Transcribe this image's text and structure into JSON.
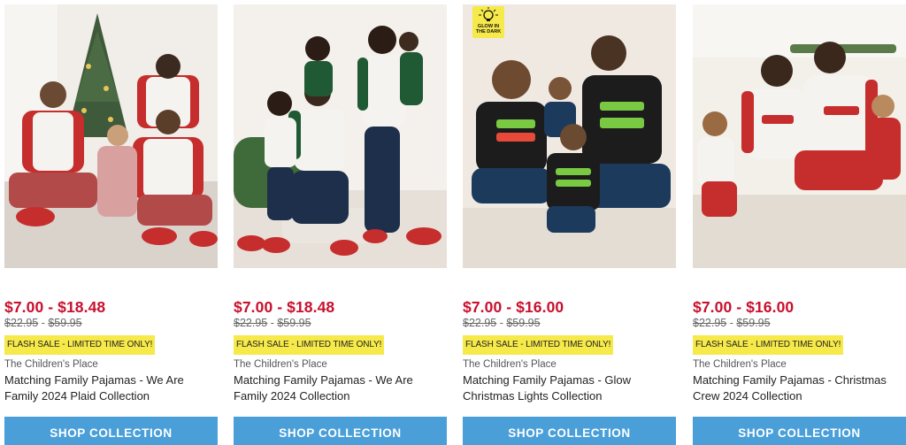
{
  "products": [
    {
      "price": "$7.00 - $18.48",
      "was_low": "$22.95",
      "was_sep": " - ",
      "was_high": "$59.95",
      "flash": "FLASH SALE - LIMITED TIME ONLY!",
      "brand": "The Children's Place",
      "title": "Matching Family Pajamas - We Are Family 2024 Plaid Collection",
      "cta": "SHOP COLLECTION",
      "image_alt": "Family in red plaid pajamas by a Christmas tree"
    },
    {
      "price": "$7.00 - $18.48",
      "was_low": "$22.95",
      "was_sep": " - ",
      "was_high": "$59.95",
      "flash": "FLASH SALE - LIMITED TIME ONLY!",
      "brand": "The Children's Place",
      "title": "Matching Family Pajamas - We Are Family 2024 Collection",
      "cta": "SHOP COLLECTION",
      "image_alt": "Family in green plaid pajamas"
    },
    {
      "price": "$7.00 - $16.00",
      "was_low": "$22.95",
      "was_sep": " - ",
      "was_high": "$59.95",
      "flash": "FLASH SALE - LIMITED TIME ONLY!",
      "brand": "The Children's Place",
      "title": "Matching Family Pajamas - Glow Christmas Lights Collection",
      "cta": "SHOP COLLECTION",
      "badge_line1": "GLOW IN",
      "badge_line2": "THE DARK",
      "image_alt": "Family in black Let It Glow pajamas"
    },
    {
      "price": "$7.00 - $16.00",
      "was_low": "$22.95",
      "was_sep": " - ",
      "was_high": "$59.95",
      "flash": "FLASH SALE - LIMITED TIME ONLY!",
      "brand": "The Children's Place",
      "title": "Matching Family Pajamas - Christmas Crew 2024 Collection",
      "cta": "SHOP COLLECTION",
      "image_alt": "Family in red Christmas Crew pajamas"
    }
  ],
  "colors": {
    "sale_price": "#c8102e",
    "flash_bg": "#f6e94a",
    "cta_bg": "#4a9fd8",
    "cta_text": "#ffffff"
  }
}
